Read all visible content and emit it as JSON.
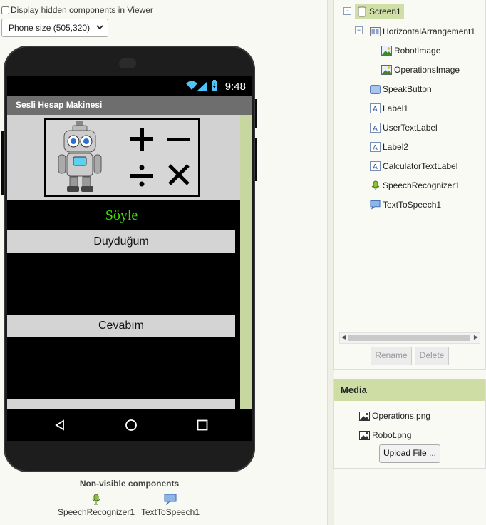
{
  "viewer": {
    "hidden_checkbox_label": "Display hidden components in Viewer",
    "phone_size": "Phone size (505,320)"
  },
  "phone": {
    "status_time": "9:48",
    "app_title": "Sesli Hesap Makinesi",
    "speak_button": "Söyle",
    "user_text_label": "Duyduğum",
    "calculator_text_label": "Cevabım"
  },
  "nonvisible": {
    "title": "Non-visible components",
    "items": [
      "SpeechRecognizer1",
      "TextToSpeech1"
    ]
  },
  "tree": {
    "screen": "Screen1",
    "harrangement": "HorizontalArrangement1",
    "robot_image": "RobotImage",
    "operations_image": "OperationsImage",
    "speak_button": "SpeakButton",
    "label1": "Label1",
    "user_text_label": "UserTextLabel",
    "label2": "Label2",
    "calculator_text_label": "CalculatorTextLabel",
    "speech_recognizer": "SpeechRecognizer1",
    "tts": "TextToSpeech1",
    "rename": "Rename",
    "delete": "Delete"
  },
  "media": {
    "title": "Media",
    "files": [
      "Operations.png",
      "Robot.png"
    ],
    "upload": "Upload File ..."
  },
  "colors": {
    "accent_green": "#cddda3",
    "speak_text": "#3ee000",
    "phone_scrollbar": "#c8d6a0"
  }
}
